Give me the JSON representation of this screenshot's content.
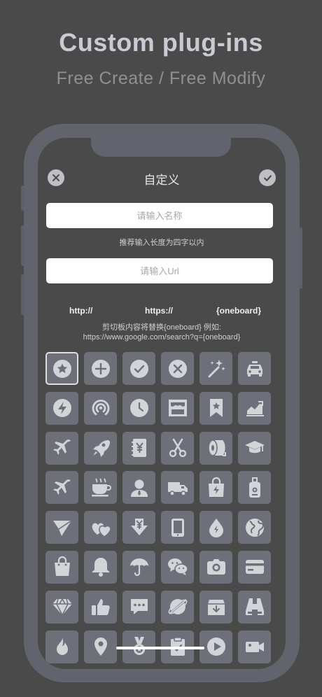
{
  "hero": {
    "title": "Custom plug-ins",
    "subtitle": "Free Create / Free Modify"
  },
  "nav": {
    "close_icon": "close-icon",
    "title": "自定义",
    "confirm_icon": "checkmark-icon"
  },
  "form": {
    "name_placeholder": "请输入名称",
    "name_value": "",
    "name_hint": "推荐输入长度为四字以内",
    "url_placeholder": "请输入Url",
    "url_value": ""
  },
  "shortcuts": [
    "http://",
    "https://",
    "{oneboard}"
  ],
  "clipboard_note": {
    "line1": "剪切板内容将替换{oneboard} 例如:",
    "line2": "https://www.google.com/search?q={oneboard}"
  },
  "icons": [
    "star-icon",
    "plus-icon",
    "checkmark-icon",
    "close-icon",
    "magic-wand-icon",
    "taxi-icon",
    "lightning-icon",
    "airdrop-icon",
    "clock-icon",
    "store-icon",
    "bookmark-icon",
    "trending-chart-icon",
    "airplane-icon",
    "rocket-icon",
    "yen-notebook-icon",
    "scissors-icon",
    "toilet-paper-icon",
    "graduation-cap-icon",
    "airplane-icon",
    "coffee-cup-icon",
    "person-icon",
    "truck-icon",
    "power-bag-icon",
    "luggage-tag-icon",
    "paper-plane-icon",
    "hearts-icon",
    "yen-download-icon",
    "tablet-icon",
    "water-drop-icon",
    "globe-icon",
    "shopping-bag-icon",
    "bell-icon",
    "umbrella-icon",
    "wechat-icon",
    "camera-icon",
    "credit-card-icon",
    "diamond-icon",
    "thumbs-up-icon",
    "chat-bubble-icon",
    "no-planet-icon",
    "download-box-icon",
    "binoculars-icon",
    "fire-icon",
    "location-pin-icon",
    "medal-icon",
    "clipboard-check-icon",
    "play-icon",
    "video-camera-icon"
  ],
  "selected_icon_index": 0,
  "colors": {
    "background": "#4a4a4a",
    "phone_frame": "#62646d",
    "tile": "#6e7079",
    "icon": "#d3d4d8"
  }
}
